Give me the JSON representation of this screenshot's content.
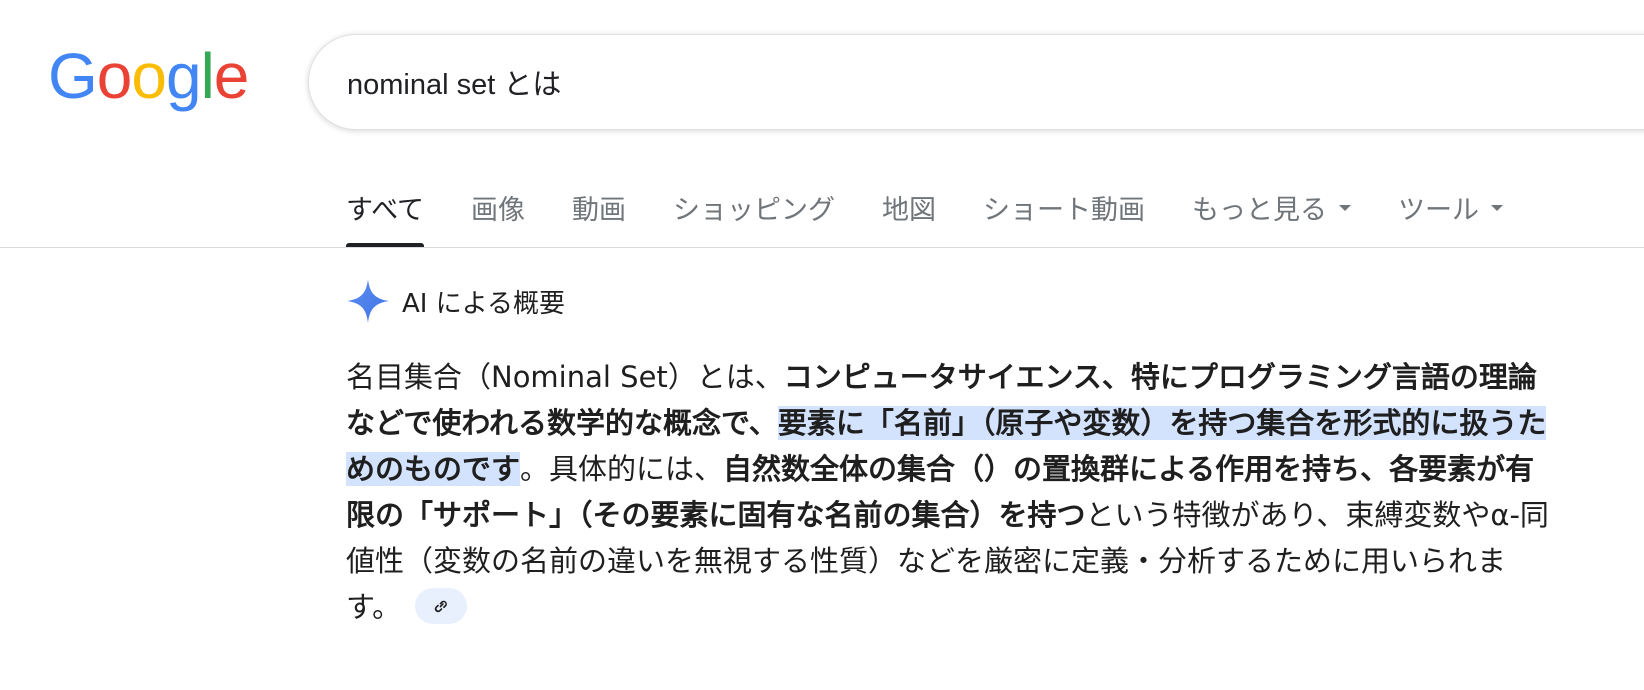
{
  "logo": {
    "letters": [
      "G",
      "o",
      "o",
      "g",
      "l",
      "e"
    ],
    "colors": [
      "#4285F4",
      "#EA4335",
      "#FBBC05",
      "#4285F4",
      "#34A853",
      "#EA4335"
    ]
  },
  "search": {
    "query": "nominal set とは"
  },
  "tabs": [
    {
      "label": "すべて",
      "active": true
    },
    {
      "label": "画像"
    },
    {
      "label": "動画"
    },
    {
      "label": "ショッピング"
    },
    {
      "label": "地図"
    },
    {
      "label": "ショート動画"
    },
    {
      "label": "もっと見る",
      "dropdown": true
    },
    {
      "label": "ツール",
      "dropdown": true
    }
  ],
  "ai_overview": {
    "title": "AI による概要",
    "icon": "sparkle-icon",
    "accent": "#4285F4",
    "highlight_color": "#d3e3fd",
    "segments": {
      "s1": "名目集合（Nominal Set）とは、",
      "s2": "コンピュータサイエンス、特にプログラミング言語の理論などで使われる数学的な概念で、",
      "s3": "要素に「名前」（原子や変数）を持つ集合を形式的に扱うためのものです",
      "s4": "。具体的には、",
      "s5": "自然数全体の集合（）の置換群による作用を持ち、各要素が有限の「サポート」（その要素に固有な名前の集合）を持つ",
      "s6": "という特徴があり、束縛変数やα-同値性（変数の名前の違いを無視する性質）などを厳密に定義・分析するために用いられます。"
    },
    "link_icon": "link-icon"
  }
}
